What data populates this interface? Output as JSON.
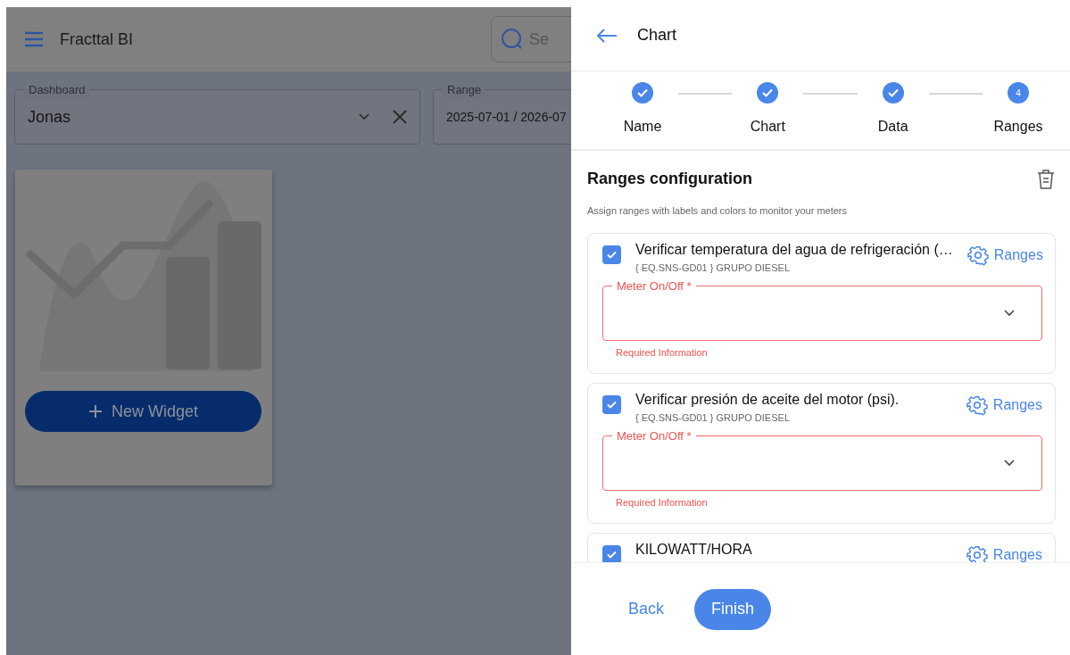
{
  "app": {
    "title": "Fracttal BI",
    "search": {
      "placeholder": "Se"
    }
  },
  "filters": [
    {
      "label": "Dashboard",
      "value": "Jonas",
      "clearable": true
    },
    {
      "label": "Range",
      "value": "2025-07-01 / 2026-07",
      "clearable": false
    }
  ],
  "widget_card": {
    "button": "New Widget"
  },
  "panel": {
    "title": "Chart",
    "steps": [
      {
        "label": "Name",
        "completed": true
      },
      {
        "label": "Chart",
        "completed": true
      },
      {
        "label": "Data",
        "completed": true
      },
      {
        "label": "Ranges",
        "completed": false,
        "number": "4"
      }
    ],
    "section_title": "Ranges configuration",
    "section_hint": "Assign ranges with labels and colors to monitor your meters",
    "meters": [
      {
        "title": "Verificar temperatura del agua de refrigeración (…",
        "subtitle": "{ EQ.SNS-GD01 } GRUPO DIESEL",
        "checked": true,
        "link": "Ranges",
        "field_label": "Meter On/Off *",
        "error": "Required Information"
      },
      {
        "title": "Verificar presión de aceite del motor (psi).",
        "subtitle": "{ EQ.SNS-GD01 } GRUPO DIESEL",
        "checked": true,
        "link": "Ranges",
        "field_label": "Meter On/Off *",
        "error": "Required Information"
      },
      {
        "title": "KILOWATT/HORA",
        "checked": true,
        "link": "Ranges"
      }
    ],
    "buttons": [
      {
        "label": "Back",
        "kind": "text"
      },
      {
        "label": "Finish",
        "kind": "filled"
      }
    ]
  }
}
